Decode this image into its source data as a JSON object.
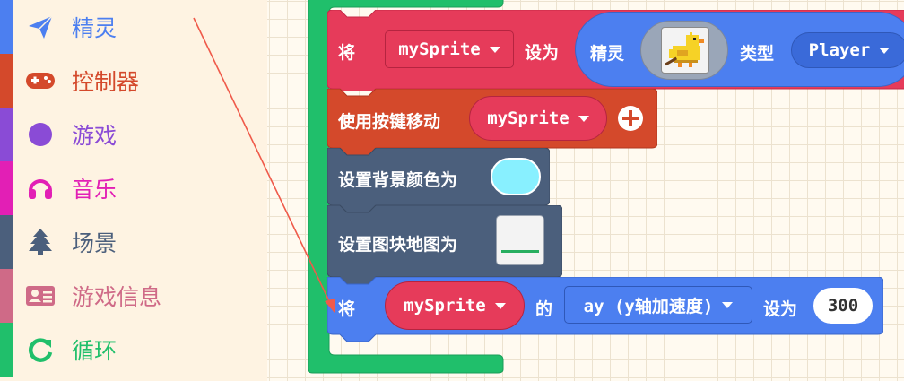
{
  "toolbox": {
    "categories": [
      {
        "label": "精灵",
        "color": "#4c7ff0",
        "icon": "paper-plane-icon"
      },
      {
        "label": "控制器",
        "color": "#d4492b",
        "icon": "gamepad-icon"
      },
      {
        "label": "游戏",
        "color": "#8a4bd6",
        "icon": "circle-icon"
      },
      {
        "label": "音乐",
        "color": "#e21fb5",
        "icon": "headphones-icon"
      },
      {
        "label": "场景",
        "color": "#4b5f7c",
        "icon": "tree-icon"
      },
      {
        "label": "游戏信息",
        "color": "#cf6a87",
        "icon": "id-card-icon"
      },
      {
        "label": "循环",
        "color": "#20bf6b",
        "icon": "refresh-icon"
      }
    ]
  },
  "blocks": {
    "set_sprite": {
      "keyword": "将",
      "variable": "mySprite",
      "set_to": "设为",
      "create_label": "精灵",
      "kind_label": "类型",
      "kind_value": "Player",
      "color": "#e63b5a"
    },
    "move_buttons": {
      "label": "使用按键移动",
      "variable": "mySprite",
      "color": "#d4492b"
    },
    "set_background": {
      "label": "设置背景颜色为",
      "swatch_color": "#88f0ff",
      "color": "#4b5f7c"
    },
    "set_tilemap": {
      "label": "设置图块地图为",
      "color": "#4b5f7c"
    },
    "set_property": {
      "keyword": "将",
      "variable": "mySprite",
      "of": "的",
      "property": "ay (y轴加速度)",
      "set_to": "设为",
      "value": "300",
      "color": "#4c7ff0"
    }
  },
  "colors": {
    "on_start": "#20bf6b",
    "drag_arrow": "#ef5a4a"
  }
}
